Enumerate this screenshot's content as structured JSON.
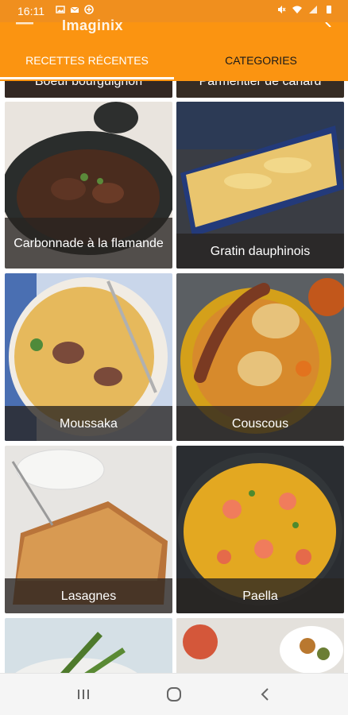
{
  "status": {
    "time": "16:11",
    "left_icons": [
      "image-icon",
      "mail-icon",
      "data-saver-icon"
    ],
    "right_icons": [
      "mute-icon",
      "wifi-icon",
      "signal-icon",
      "battery-icon"
    ]
  },
  "app_bar": {
    "title": "Imaginix",
    "accent_color": "#fb9411",
    "tabs": [
      {
        "label": "RECETTES RÉCENTES",
        "active": true
      },
      {
        "label": "CATEGORIES",
        "active": false
      }
    ]
  },
  "recipes": [
    {
      "name": "Boeuf bourguignon"
    },
    {
      "name": "Parmentier de canard"
    },
    {
      "name": "Carbonnade à la flamande"
    },
    {
      "name": "Gratin dauphinois"
    },
    {
      "name": "Moussaka"
    },
    {
      "name": "Couscous"
    },
    {
      "name": "Lasagnes"
    },
    {
      "name": "Paella"
    },
    {
      "name": ""
    },
    {
      "name": ""
    }
  ],
  "nav": {
    "icons": [
      "recent-apps-icon",
      "home-icon",
      "back-icon"
    ]
  }
}
